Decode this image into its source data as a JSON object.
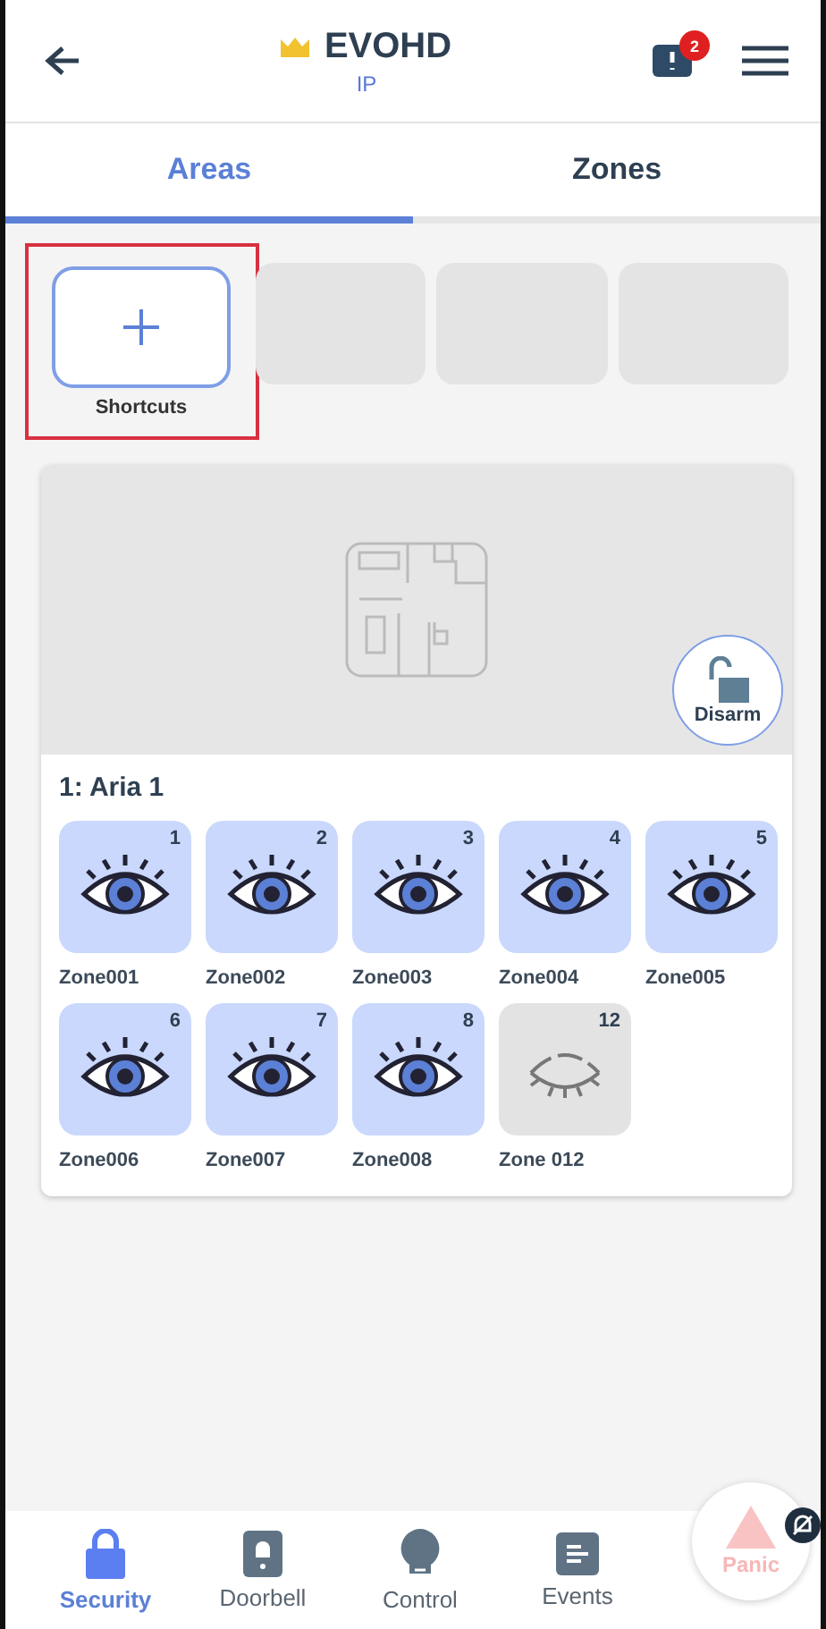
{
  "header": {
    "title": "EVOHD",
    "subtitle": "IP",
    "notification_count": "2"
  },
  "tabs": [
    {
      "label": "Areas",
      "selected": true
    },
    {
      "label": "Zones",
      "selected": false
    }
  ],
  "shortcuts": {
    "label": "Shortcuts",
    "highlighted": true
  },
  "area": {
    "name": "1: Aria 1",
    "arm_button": "Disarm",
    "zones": [
      {
        "number": "1",
        "name": "Zone001",
        "active": true
      },
      {
        "number": "2",
        "name": "Zone002",
        "active": true
      },
      {
        "number": "3",
        "name": "Zone003",
        "active": true
      },
      {
        "number": "4",
        "name": "Zone004",
        "active": true
      },
      {
        "number": "5",
        "name": "Zone005",
        "active": true
      },
      {
        "number": "6",
        "name": "Zone006",
        "active": true
      },
      {
        "number": "7",
        "name": "Zone007",
        "active": true
      },
      {
        "number": "8",
        "name": "Zone008",
        "active": true
      },
      {
        "number": "12",
        "name": "Zone 012",
        "active": false
      }
    ]
  },
  "nav": [
    {
      "kind": "lock",
      "label": "Security",
      "selected": true
    },
    {
      "kind": "doorbell",
      "label": "Doorbell",
      "selected": false
    },
    {
      "kind": "bulb",
      "label": "Control",
      "selected": false
    },
    {
      "kind": "events",
      "label": "Events",
      "selected": false
    }
  ],
  "panic": {
    "label": "Panic",
    "disabled": true
  }
}
